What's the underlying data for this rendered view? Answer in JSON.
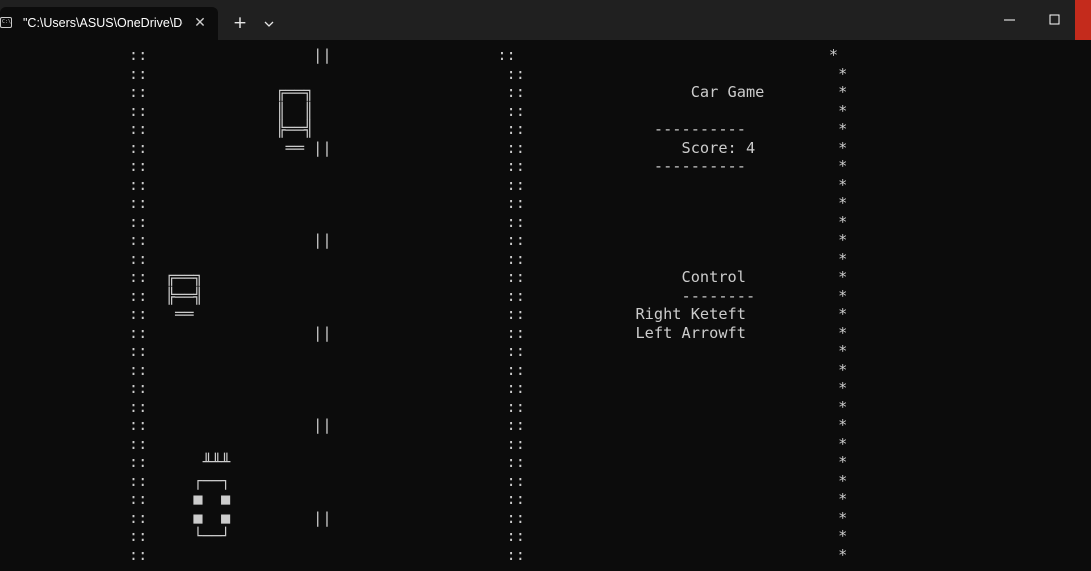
{
  "window": {
    "tab_title": "\"C:\\Users\\ASUS\\OneDrive\\De",
    "tab_icon": "cmd-prompt-icon",
    "close_tab_label": "✕",
    "new_tab_label": "+",
    "minimize_icon": "minimize-icon",
    "maximize_icon": "maximize-icon",
    "close_window_icon": "close-icon"
  },
  "console": {
    "lines": [
      "              ::                  ||                  ::                                  *",
      "              ::                                       ::                                  *",
      "              ::              ╔══╗                     ::                  Car Game        *",
      "              ::              ║  ║                     ::                                  *",
      "              ::              ╠══╣                     ::              ----------          *",
      "              ::               ══ ||                   ::                 Score: 4         *",
      "              ::                                       ::              ----------          *",
      "              ::                                       ::                                  *",
      "              ::                                       ::                                  *",
      "              ::                                       ::                                  *",
      "              ::                  ||                   ::                                  *",
      "              ::                                       ::                                  *",
      "              ::  ╔══╗                                 ::                 Control          *",
      "              ::  ╠══╣                                 ::                 --------         *",
      "              ::   ══                                  ::            Right Keteft          *",
      "              ::                  ||                   ::            Left Arrowft          *",
      "              ::                                       ::                                  *",
      "              ::                                       ::                                  *",
      "              ::                                       ::                                  *",
      "              ::                                       ::                                  *",
      "              ::                  ||                   ::                                  *",
      "              ::                                       ::                                  *",
      "              ::      ╨╨╨                              ::                                  *",
      "              ::     ┌──┐                              ::                                  *",
      "              ::     ■  ■                              ::                                  *",
      "              ::     ■  ■         ||                   ::                                  *",
      "              ::     └──┘                              ::                                  *",
      "              ::                                       ::                                  *"
    ]
  }
}
